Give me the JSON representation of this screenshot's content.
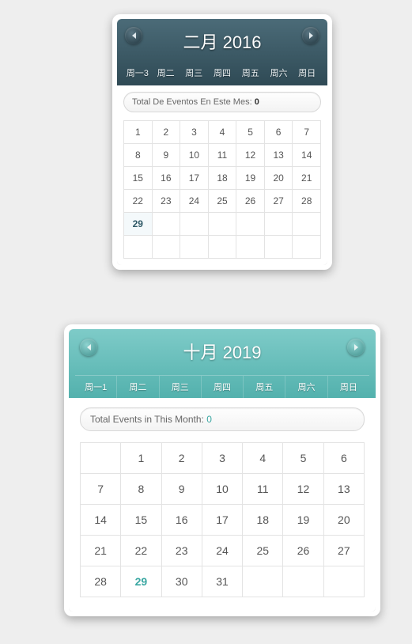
{
  "cal1": {
    "title": "二月 2016",
    "dow": [
      "周一3",
      "周二",
      "周三",
      "周四",
      "周五",
      "周六",
      "周日"
    ],
    "summary_label": "Total De Eventos En Este Mes: ",
    "summary_count": "0",
    "leading_blanks": 0,
    "days": [
      1,
      2,
      3,
      4,
      5,
      6,
      7,
      8,
      9,
      10,
      11,
      12,
      13,
      14,
      15,
      16,
      17,
      18,
      19,
      20,
      21,
      22,
      23,
      24,
      25,
      26,
      27,
      28,
      29
    ],
    "today": 29,
    "rows": 6
  },
  "cal2": {
    "title": "十月 2019",
    "dow": [
      "周一1",
      "周二",
      "周三",
      "周四",
      "周五",
      "周六",
      "周日"
    ],
    "summary_label": "Total Events in This Month: ",
    "summary_count": "0",
    "leading_blanks": 1,
    "days": [
      1,
      2,
      3,
      4,
      5,
      6,
      7,
      8,
      9,
      10,
      11,
      12,
      13,
      14,
      15,
      16,
      17,
      18,
      19,
      20,
      21,
      22,
      23,
      24,
      25,
      26,
      27,
      28,
      29,
      30,
      31
    ],
    "today": 29,
    "rows": 5
  }
}
